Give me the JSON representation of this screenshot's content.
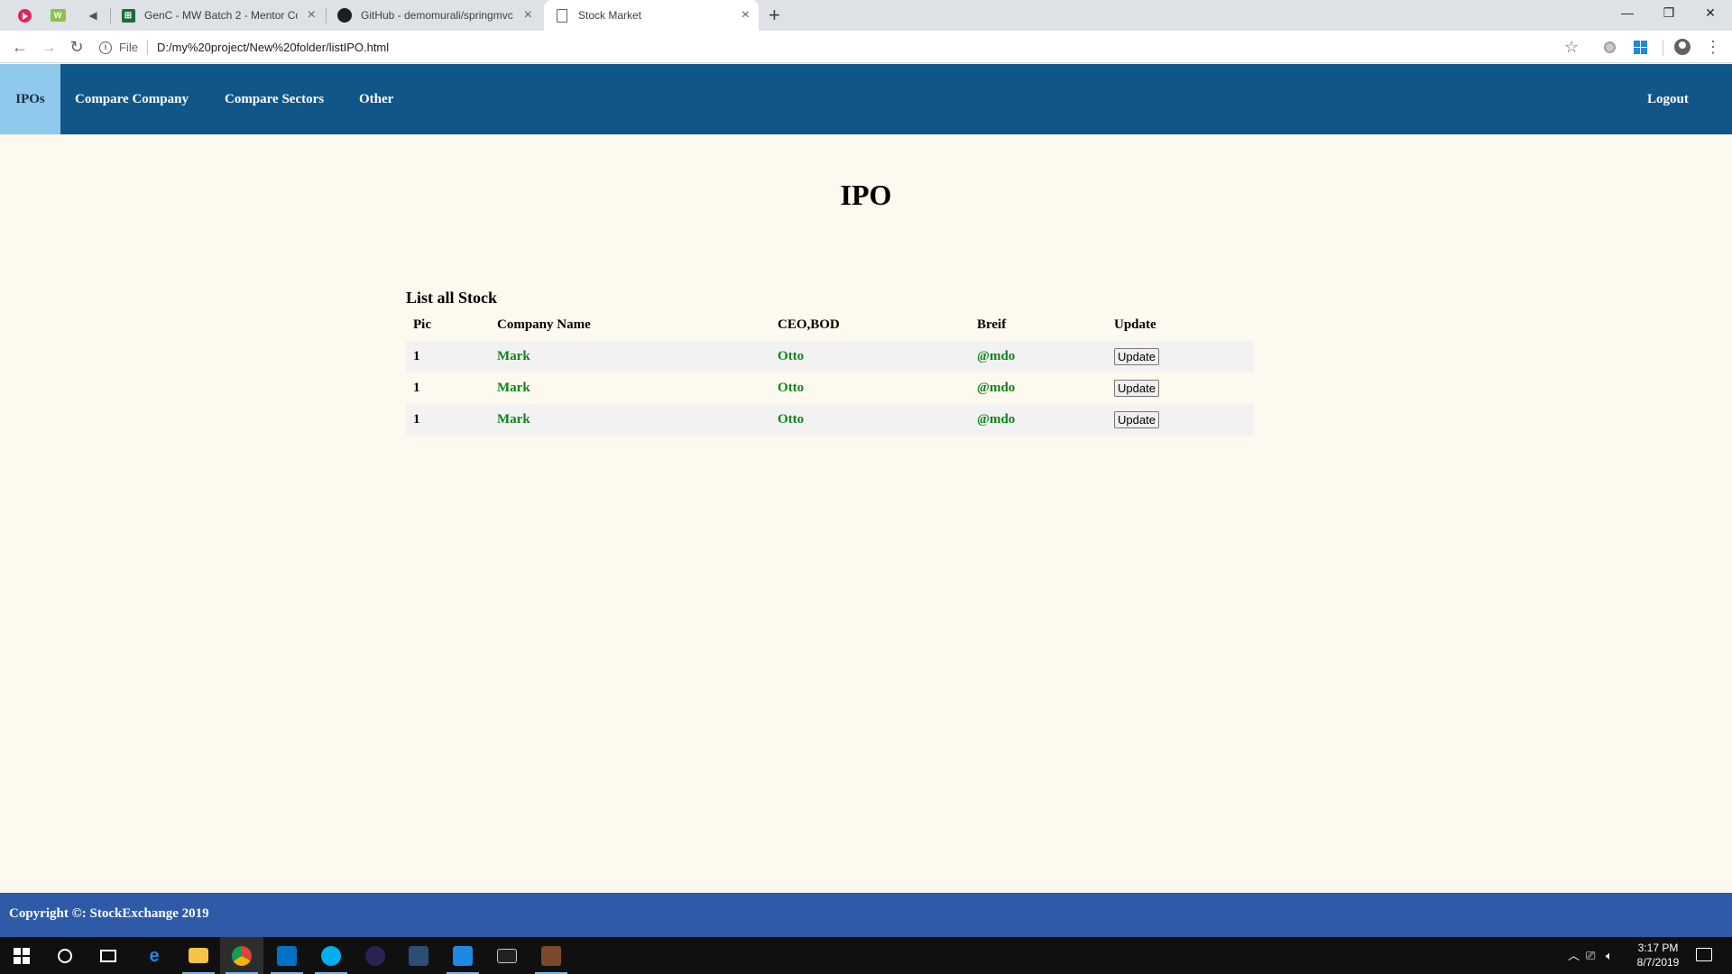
{
  "browser": {
    "tabs": [
      {
        "title": "GenC - MW Batch 2 - Mentor Co",
        "favicon": "sheets-icon"
      },
      {
        "title": "GitHub - demomurali/springmvc",
        "favicon": "github-icon"
      },
      {
        "title": "Stock Market",
        "favicon": "page-icon"
      }
    ],
    "new_tab_symbol": "+",
    "address": {
      "scheme": "File",
      "url": "D:/my%20project/New%20folder/listIPO.html"
    }
  },
  "nav": {
    "items": [
      "IPOs",
      "Compare Company",
      "Compare Sectors",
      "Other"
    ],
    "active": "IPOs",
    "logout": "Logout"
  },
  "main": {
    "title": "IPO",
    "table": {
      "caption": "List all Stock",
      "headers": [
        "Pic",
        "Company Name",
        "CEO,BOD",
        "Breif",
        "Update"
      ],
      "rows": [
        {
          "pic": "1",
          "company": "Mark",
          "ceo": "Otto",
          "brief": "@mdo",
          "button": "Update"
        },
        {
          "pic": "1",
          "company": "Mark",
          "ceo": "Otto",
          "brief": "@mdo",
          "button": "Update"
        },
        {
          "pic": "1",
          "company": "Mark",
          "ceo": "Otto",
          "brief": "@mdo",
          "button": "Update"
        }
      ]
    }
  },
  "footer": {
    "text": "Copyright ©: StockExchange 2019"
  },
  "taskbar": {
    "time": "3:17 PM",
    "date": "8/7/2019"
  },
  "colors": {
    "nav_bg": "#115689",
    "nav_active": "#8ec9ec",
    "page_bg": "#fdf9ef",
    "footer_bg": "#2e5aa8",
    "link_green": "#12821c"
  }
}
